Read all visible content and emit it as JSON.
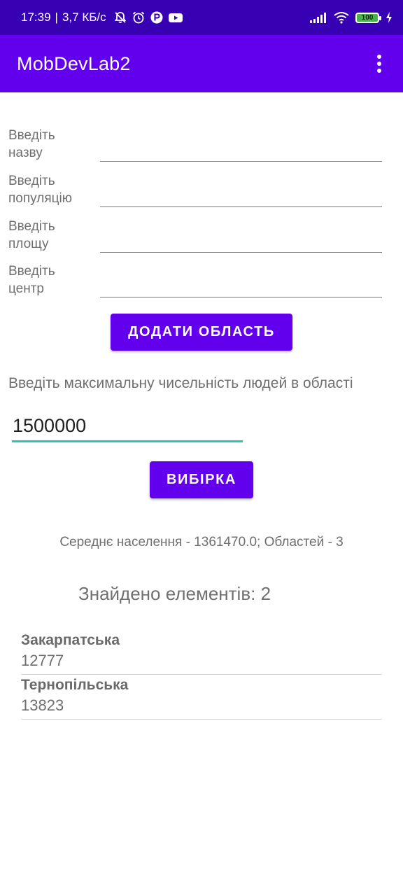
{
  "status_bar": {
    "time": "17:39",
    "separator": "|",
    "speed": "3,7 КБ/с",
    "battery": "100",
    "icons": [
      "bell-off-icon",
      "alarm-icon",
      "app-icon",
      "youtube-icon",
      "signal-icon",
      "wifi-icon",
      "battery-icon",
      "charging-icon"
    ]
  },
  "app_bar": {
    "title": "MobDevLab2",
    "menu_icon": "more-vert-icon"
  },
  "form": {
    "fields": [
      {
        "label": "Введіть назву",
        "value": ""
      },
      {
        "label": "Введіть популяцію",
        "value": ""
      },
      {
        "label": "Введіть площу",
        "value": ""
      },
      {
        "label": "Введіть центр",
        "value": ""
      }
    ],
    "add_button": "ДОДАТИ ОБЛАСТЬ"
  },
  "filter": {
    "label": "Введіть максимальну чисельність людей в області",
    "value": "1500000",
    "select_button": "ВИБІРКА"
  },
  "summary": "Середнє населення - 1361470.0; Областей - 3",
  "found": "Знайдено елементів: 2",
  "results": [
    {
      "name": "Закарпатська",
      "value": "12777"
    },
    {
      "name": "Тернопільська",
      "value": "13823"
    }
  ],
  "colors": {
    "status_bar": "#3700b3",
    "app_bar": "#6200ee",
    "button": "#6200ee",
    "input_focus": "#26c6b6"
  }
}
